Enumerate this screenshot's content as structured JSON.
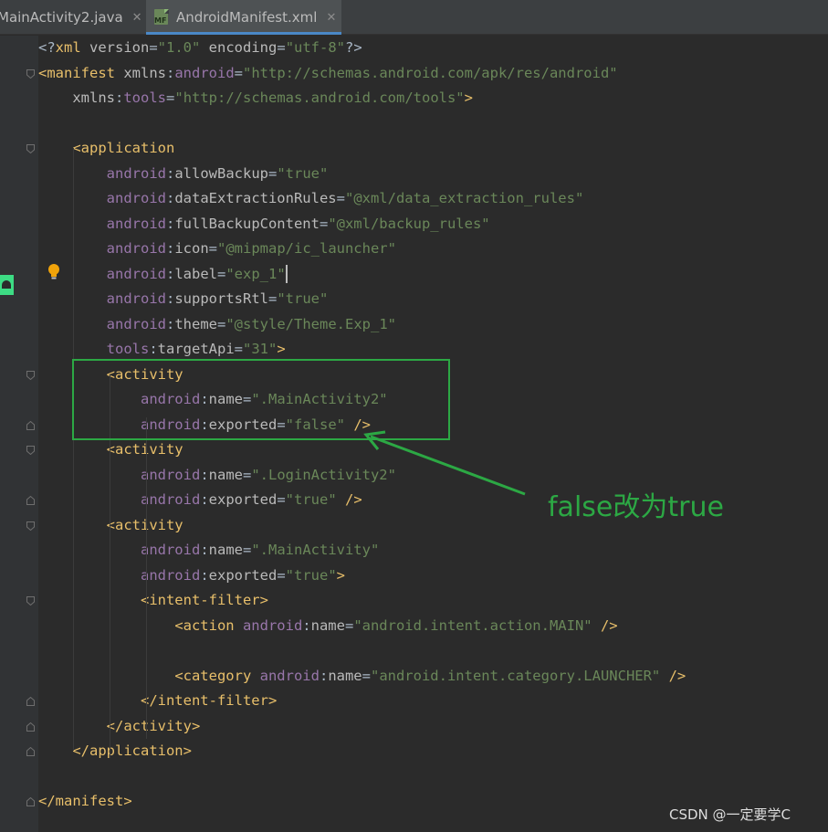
{
  "tabs": [
    {
      "label": "MainActivity2.java",
      "close": "✕",
      "icon": "java-file-icon",
      "active": false
    },
    {
      "label": "AndroidManifest.xml",
      "close": "✕",
      "icon": "manifest-file-icon",
      "icon_text": "MF",
      "active": true
    }
  ],
  "editor": {
    "lines": [
      [
        [
          "pun",
          "<?"
        ],
        [
          "tag",
          "xml "
        ],
        [
          "attr",
          "version"
        ],
        [
          "pun",
          "="
        ],
        [
          "val",
          "\"1.0\""
        ],
        [
          "attr",
          " encoding"
        ],
        [
          "pun",
          "="
        ],
        [
          "val",
          "\"utf-8\""
        ],
        [
          "pun",
          "?>"
        ]
      ],
      [
        [
          "tag",
          "<manifest "
        ],
        [
          "attr",
          "xmlns"
        ],
        [
          "pun",
          ":"
        ],
        [
          "ns",
          "android"
        ],
        [
          "pun",
          "="
        ],
        [
          "val",
          "\"http://schemas.android.com/apk/res/android\""
        ]
      ],
      [
        [
          "pun",
          "    "
        ],
        [
          "attr",
          "xmlns"
        ],
        [
          "pun",
          ":"
        ],
        [
          "ns",
          "tools"
        ],
        [
          "pun",
          "="
        ],
        [
          "val",
          "\"http://schemas.android.com/tools\""
        ],
        [
          "tag",
          ">"
        ]
      ],
      [],
      [
        [
          "pun",
          "    "
        ],
        [
          "tag",
          "<application"
        ]
      ],
      [
        [
          "pun",
          "        "
        ],
        [
          "ns",
          "android"
        ],
        [
          "pun",
          ":"
        ],
        [
          "attr",
          "allowBackup"
        ],
        [
          "pun",
          "="
        ],
        [
          "val",
          "\"true\""
        ]
      ],
      [
        [
          "pun",
          "        "
        ],
        [
          "ns",
          "android"
        ],
        [
          "pun",
          ":"
        ],
        [
          "attr",
          "dataExtractionRules"
        ],
        [
          "pun",
          "="
        ],
        [
          "val",
          "\"@xml/data_extraction_rules\""
        ]
      ],
      [
        [
          "pun",
          "        "
        ],
        [
          "ns",
          "android"
        ],
        [
          "pun",
          ":"
        ],
        [
          "attr",
          "fullBackupContent"
        ],
        [
          "pun",
          "="
        ],
        [
          "val",
          "\"@xml/backup_rules\""
        ]
      ],
      [
        [
          "pun",
          "        "
        ],
        [
          "ns",
          "android"
        ],
        [
          "pun",
          ":"
        ],
        [
          "attr",
          "icon"
        ],
        [
          "pun",
          "="
        ],
        [
          "val",
          "\"@mipmap/ic_launcher\""
        ]
      ],
      [
        [
          "pun",
          "        "
        ],
        [
          "ns",
          "android"
        ],
        [
          "pun",
          ":"
        ],
        [
          "attr",
          "label"
        ],
        [
          "pun",
          "="
        ],
        [
          "val",
          "\"exp_1\""
        ],
        [
          "caret",
          ""
        ]
      ],
      [
        [
          "pun",
          "        "
        ],
        [
          "ns",
          "android"
        ],
        [
          "pun",
          ":"
        ],
        [
          "attr",
          "supportsRtl"
        ],
        [
          "pun",
          "="
        ],
        [
          "val",
          "\"true\""
        ]
      ],
      [
        [
          "pun",
          "        "
        ],
        [
          "ns",
          "android"
        ],
        [
          "pun",
          ":"
        ],
        [
          "attr",
          "theme"
        ],
        [
          "pun",
          "="
        ],
        [
          "val",
          "\"@style/Theme.Exp_1\""
        ]
      ],
      [
        [
          "pun",
          "        "
        ],
        [
          "ns",
          "tools"
        ],
        [
          "pun",
          ":"
        ],
        [
          "attr",
          "targetApi"
        ],
        [
          "pun",
          "="
        ],
        [
          "val",
          "\"31\""
        ],
        [
          "tag",
          ">"
        ]
      ],
      [
        [
          "pun",
          "        "
        ],
        [
          "tag",
          "<activity"
        ]
      ],
      [
        [
          "pun",
          "            "
        ],
        [
          "ns",
          "android"
        ],
        [
          "pun",
          ":"
        ],
        [
          "attr",
          "name"
        ],
        [
          "pun",
          "="
        ],
        [
          "val",
          "\".MainActivity2\""
        ]
      ],
      [
        [
          "pun",
          "            "
        ],
        [
          "ns",
          "android"
        ],
        [
          "pun",
          ":"
        ],
        [
          "attr",
          "exported"
        ],
        [
          "pun",
          "="
        ],
        [
          "val",
          "\"false\""
        ],
        [
          "tag",
          " />"
        ]
      ],
      [
        [
          "pun",
          "        "
        ],
        [
          "tag",
          "<activity"
        ]
      ],
      [
        [
          "pun",
          "            "
        ],
        [
          "ns",
          "android"
        ],
        [
          "pun",
          ":"
        ],
        [
          "attr",
          "name"
        ],
        [
          "pun",
          "="
        ],
        [
          "val",
          "\".LoginActivity2\""
        ]
      ],
      [
        [
          "pun",
          "            "
        ],
        [
          "ns",
          "android"
        ],
        [
          "pun",
          ":"
        ],
        [
          "attr",
          "exported"
        ],
        [
          "pun",
          "="
        ],
        [
          "val",
          "\"true\""
        ],
        [
          "tag",
          " />"
        ]
      ],
      [
        [
          "pun",
          "        "
        ],
        [
          "tag",
          "<activity"
        ]
      ],
      [
        [
          "pun",
          "            "
        ],
        [
          "ns",
          "android"
        ],
        [
          "pun",
          ":"
        ],
        [
          "attr",
          "name"
        ],
        [
          "pun",
          "="
        ],
        [
          "val",
          "\".MainActivity\""
        ]
      ],
      [
        [
          "pun",
          "            "
        ],
        [
          "ns",
          "android"
        ],
        [
          "pun",
          ":"
        ],
        [
          "attr",
          "exported"
        ],
        [
          "pun",
          "="
        ],
        [
          "val",
          "\"true\""
        ],
        [
          "tag",
          ">"
        ]
      ],
      [
        [
          "pun",
          "            "
        ],
        [
          "tag",
          "<intent-filter>"
        ]
      ],
      [
        [
          "pun",
          "                "
        ],
        [
          "tag",
          "<action "
        ],
        [
          "ns",
          "android"
        ],
        [
          "pun",
          ":"
        ],
        [
          "attr",
          "name"
        ],
        [
          "pun",
          "="
        ],
        [
          "val",
          "\"android.intent.action.MAIN\""
        ],
        [
          "tag",
          " />"
        ]
      ],
      [],
      [
        [
          "pun",
          "                "
        ],
        [
          "tag",
          "<category "
        ],
        [
          "ns",
          "android"
        ],
        [
          "pun",
          ":"
        ],
        [
          "attr",
          "name"
        ],
        [
          "pun",
          "="
        ],
        [
          "val",
          "\"android.intent.category.LAUNCHER\""
        ],
        [
          "tag",
          " />"
        ]
      ],
      [
        [
          "pun",
          "            "
        ],
        [
          "tag",
          "</intent-filter>"
        ]
      ],
      [
        [
          "pun",
          "        "
        ],
        [
          "tag",
          "</activity>"
        ]
      ],
      [
        [
          "pun",
          "    "
        ],
        [
          "tag",
          "</application>"
        ]
      ],
      [],
      [
        [
          "tag",
          "</manifest>"
        ]
      ]
    ]
  },
  "gutter_icons": [
    "android-icon",
    "lightbulb-icon"
  ],
  "annotation": {
    "text": "false改为true",
    "color": "#2ca844"
  },
  "watermark": "CSDN @一定要学C",
  "colors": {
    "background": "#2b2b2b",
    "tag": "#e8bf6a",
    "namespace": "#9876aa",
    "attribute": "#bababa",
    "value": "#6a8759"
  }
}
